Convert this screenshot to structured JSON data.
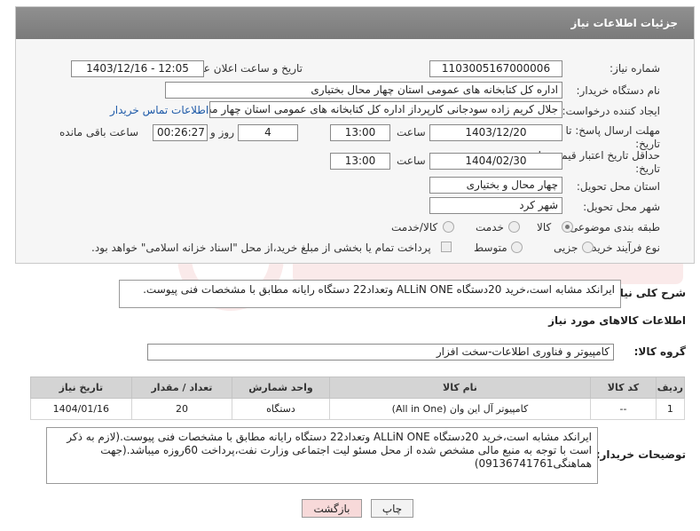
{
  "header": {
    "title": "جزئیات اطلاعات نیاز"
  },
  "form": {
    "need_number": {
      "label": "شماره نیاز:",
      "value": "1103005167000006"
    },
    "announce": {
      "label": "تاریخ و ساعت اعلان عمومی:",
      "value": "1403/12/16 - 12:05"
    },
    "buyer_org": {
      "label": "نام دستگاه خریدار:",
      "value": "اداره کل کتابخانه های عمومی استان چهار محال بختیاری"
    },
    "creator": {
      "label": "ایجاد کننده درخواست:",
      "value": "جلال کریم زاده سودجانی کارپرداز  اداره کل کتابخانه های عمومی استان چهار محال بختیاری",
      "contact_link": "اطلاعات تماس خریدار"
    },
    "reply_deadline": {
      "label": "مهلت ارسال پاسخ: تا تاریخ:",
      "date": "1403/12/20",
      "time_label": "ساعت",
      "time": "13:00",
      "days": "4",
      "days_label": "روز و",
      "remaining": "00:26:27",
      "remaining_label": "ساعت باقی مانده"
    },
    "price_validity": {
      "label": "حداقل تاریخ اعتبار قیمت: تا تاریخ:",
      "date": "1404/02/30",
      "time_label": "ساعت",
      "time": "13:00"
    },
    "province": {
      "label": "استان محل تحویل:",
      "value": "چهار محال و بختیاری"
    },
    "city": {
      "label": "شهر محل تحویل:",
      "value": "شهر کرد"
    },
    "category": {
      "label": "طبقه بندی موضوعی:",
      "options": [
        "کالا",
        "خدمت",
        "کالا/خدمت"
      ],
      "selected": "کالا"
    },
    "purchase_type": {
      "label": "نوع فرآیند خرید :",
      "options": [
        "جزیی",
        "متوسط"
      ],
      "selected": "",
      "note": "پرداخت تمام یا بخشی از مبلغ خرید،از محل \"اسناد خزانه اسلامی\" خواهد بود."
    }
  },
  "summary": {
    "label": "شرح کلی نیاز:",
    "text": "ایرانکد مشابه است،خرید 20دستگاه ALLiN ONE وتعداد22 دستگاه رایانه مطابق با مشخصات فنی پیوست."
  },
  "goods_info": {
    "title": "اطلاعات کالاهای مورد نیاز",
    "group_label": "گروه کالا:",
    "group_value": "کامپیوتر و فناوری اطلاعات-سخت افزار"
  },
  "table": {
    "headers": [
      "ردیف",
      "کد کالا",
      "نام کالا",
      "واحد شمارش",
      "تعداد / مقدار",
      "تاریخ نیاز"
    ],
    "rows": [
      [
        "1",
        "--",
        "کامپیوتر آل این وان (All in One)",
        "دستگاه",
        "20",
        "1404/01/16"
      ]
    ]
  },
  "buyer_notes": {
    "label": "توضیحات خریدار:",
    "text": "ایرانکد مشابه است،خرید 20دستگاه ALLiN ONE وتعداد22 دستگاه رایانه مطابق با مشخصات فنی پیوست.(لازم به ذکر است با توجه به منبع مالی مشخص شده از محل مسئو لیت اجتماعی وزارت نفت،پرداخت 60روزه میباشد.(جهت هماهنگی09136741761)"
  },
  "buttons": {
    "print": "چاپ",
    "back": "بازگشت"
  },
  "colors": {
    "header_bg": "#848484",
    "link": "#1e5aa8",
    "back_btn_bg": "#f7d9d9"
  }
}
